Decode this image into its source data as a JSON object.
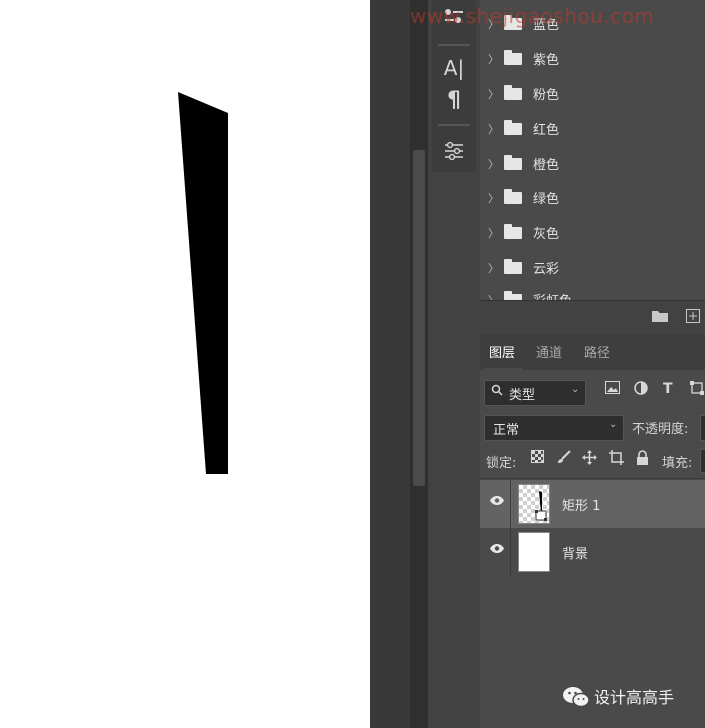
{
  "watermark": "www.shejigaoshou.com",
  "tools": {
    "character_label": "A|",
    "paragraph_label": "¶"
  },
  "swatch_groups": [
    "蓝色",
    "紫色",
    "粉色",
    "红色",
    "橙色",
    "绿色",
    "灰色",
    "云彩",
    "彩虹色"
  ],
  "layers_panel": {
    "tabs": [
      "图层",
      "通道",
      "路径"
    ],
    "filter_label": "类型",
    "blend_mode": "正常",
    "opacity_label": "不透明度:",
    "lock_label": "锁定:",
    "fill_label": "填充:",
    "layers": [
      {
        "name": "矩形 1",
        "selected": true
      },
      {
        "name": "背景",
        "selected": false
      }
    ]
  },
  "wechat_account": "设计高高手",
  "colors": {
    "panel": "#4a4a4a",
    "selected_row": "#636363",
    "watermark": "#c0392b"
  }
}
